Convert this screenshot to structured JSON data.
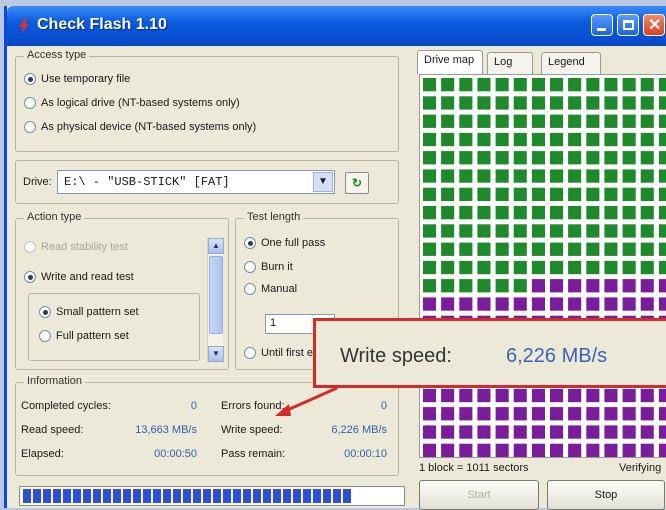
{
  "window": {
    "title": "Check Flash 1.10"
  },
  "access": {
    "legend": "Access type",
    "options": [
      {
        "label": "Use temporary file",
        "selected": true
      },
      {
        "label": "As logical drive (NT-based systems only)",
        "selected": false
      },
      {
        "label": "As physical device (NT-based systems only)",
        "selected": false
      }
    ]
  },
  "drive": {
    "label": "Drive:",
    "value": "E:\\ - \"USB-STICK\" [FAT]"
  },
  "action": {
    "legend": "Action type",
    "options": [
      {
        "label": "Read stability test",
        "selected": false
      },
      {
        "label": "Write and read test",
        "selected": true
      }
    ],
    "patterns": [
      {
        "label": "Small pattern set",
        "selected": true
      },
      {
        "label": "Full pattern set",
        "selected": false
      }
    ]
  },
  "test_length": {
    "legend": "Test length",
    "options": [
      {
        "label": "One full pass",
        "selected": true
      },
      {
        "label": "Burn it",
        "selected": false
      },
      {
        "label": "Manual",
        "selected": false
      },
      {
        "label": "Until first error",
        "selected": false
      }
    ],
    "manual_value": "1"
  },
  "info": {
    "legend": "Information",
    "completed_cycles_label": "Completed cycles:",
    "completed_cycles": "0",
    "errors_label": "Errors found:",
    "errors": "0",
    "read_speed_label": "Read speed:",
    "read_speed": "13,663 MB/s",
    "write_speed_label": "Write speed:",
    "write_speed": "6,226 MB/s",
    "elapsed_label": "Elapsed:",
    "elapsed": "00:00:50",
    "pass_remain_label": "Pass remain:",
    "pass_remain": "00:00:10"
  },
  "progress": {
    "fraction": 0.87
  },
  "tabs": [
    "Drive map",
    "Log",
    "Legend"
  ],
  "drive_map": {
    "cols": 14,
    "rows": 21,
    "written_cells": 160,
    "green": "#1e8a2c",
    "purple": "#7a1d9a"
  },
  "status": {
    "left": "1 block = 1011 sectors",
    "right": "Verifying"
  },
  "buttons": {
    "start": "Start",
    "stop": "Stop"
  },
  "callout": {
    "label": "Write speed:",
    "value": "6,226 MB/s",
    "color": "#d52a2a"
  }
}
